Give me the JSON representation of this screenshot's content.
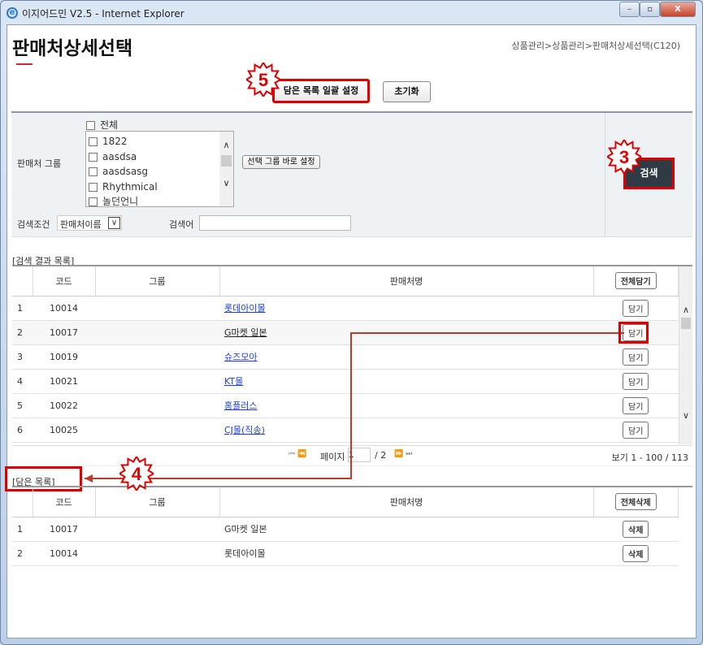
{
  "window": {
    "title": "이지어드민 V2.5 - Internet Explorer"
  },
  "header": {
    "title": "판매처상세선택",
    "breadcrumb": "상품관리>상품관리>판매처상세선택(C120)"
  },
  "toolbar": {
    "bulk_set_label": "담은 목록 일괄 설정",
    "reset_label": "초기화"
  },
  "search": {
    "group_label": "판매처 그룹",
    "all_label": "전체",
    "groups": [
      "1822",
      "aasdsa",
      "aasdsasg",
      "Rhythmical",
      "놀던언니"
    ],
    "apply_group_label": "선택 그룹 바로 설정",
    "condition_label": "검색조건",
    "condition_value": "판매처이름",
    "keyword_label": "검색어",
    "keyword_value": "",
    "search_label": "검색"
  },
  "results": {
    "section_label": "[검색 결과 목록]",
    "headers": {
      "code": "코드",
      "group": "그룹",
      "name": "판매처명",
      "add_all": "전체담기"
    },
    "add_label": "담기",
    "rows": [
      {
        "no": "1",
        "code": "10014",
        "group": "",
        "name": "롯데아이몰"
      },
      {
        "no": "2",
        "code": "10017",
        "group": "",
        "name": "G마켓 일본"
      },
      {
        "no": "3",
        "code": "10019",
        "group": "",
        "name": "슈즈모아"
      },
      {
        "no": "4",
        "code": "10021",
        "group": "",
        "name": "KT몰"
      },
      {
        "no": "5",
        "code": "10022",
        "group": "",
        "name": "홈플러스"
      },
      {
        "no": "6",
        "code": "10025",
        "group": "",
        "name": "CJ몰(직송)"
      }
    ],
    "pager": {
      "page_label": "페이지",
      "page": "1",
      "total_pages": "/ 2",
      "summary": "보기 1 - 100 / 113"
    }
  },
  "selected": {
    "section_label": "[담은 목록]",
    "headers": {
      "code": "코드",
      "group": "그룹",
      "name": "판매처명",
      "delete_all": "전체삭제"
    },
    "delete_label": "삭제",
    "rows": [
      {
        "no": "1",
        "code": "10017",
        "group": "",
        "name": "G마켓 일본"
      },
      {
        "no": "2",
        "code": "10014",
        "group": "",
        "name": "롯데아이몰"
      }
    ]
  },
  "annotations": {
    "step5": "5",
    "step3": "3",
    "step4": "4",
    "color": "#e00000"
  }
}
